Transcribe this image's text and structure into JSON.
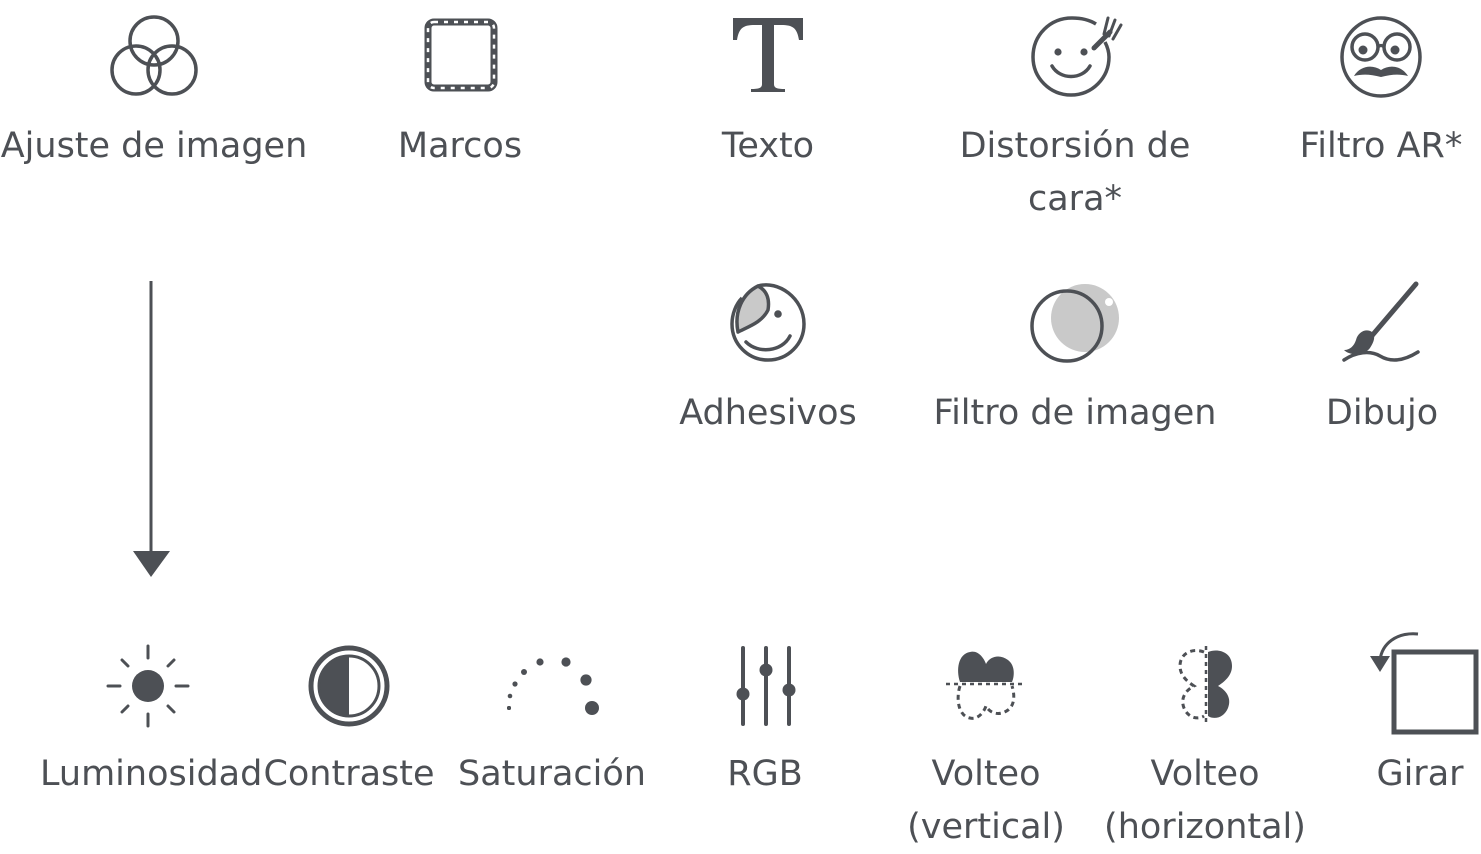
{
  "colors": {
    "icon": "#4d5055",
    "text": "#4d5055",
    "light_fill": "#c9c9c9"
  },
  "top_tools": [
    {
      "label": "Ajuste de imagen",
      "icon": "overlapping-circles-icon"
    },
    {
      "label": "Marcos",
      "icon": "frame-icon"
    },
    {
      "label": "Texto",
      "icon": "text-t-icon"
    },
    {
      "label": "Distorsión de cara*",
      "icon": "face-distort-icon"
    },
    {
      "label": "Filtro AR*",
      "icon": "ar-face-icon"
    }
  ],
  "mid_tools": [
    {
      "label": "Adhesivos",
      "icon": "sticker-icon"
    },
    {
      "label": "Filtro de imagen",
      "icon": "filter-circles-icon"
    },
    {
      "label": "Dibujo",
      "icon": "brush-icon"
    }
  ],
  "adjust_tools": [
    {
      "label": "Luminosidad",
      "icon": "sun-icon"
    },
    {
      "label": "Contraste",
      "icon": "contrast-icon"
    },
    {
      "label": "Saturación",
      "icon": "saturation-dots-icon"
    },
    {
      "label": "RGB",
      "icon": "sliders-icon"
    },
    {
      "label": "Volteo (vertical)",
      "icon": "flip-vertical-icon"
    },
    {
      "label": "Volteo (horizontal)",
      "icon": "flip-horizontal-icon"
    },
    {
      "label": "Girar",
      "icon": "rotate-icon"
    }
  ]
}
